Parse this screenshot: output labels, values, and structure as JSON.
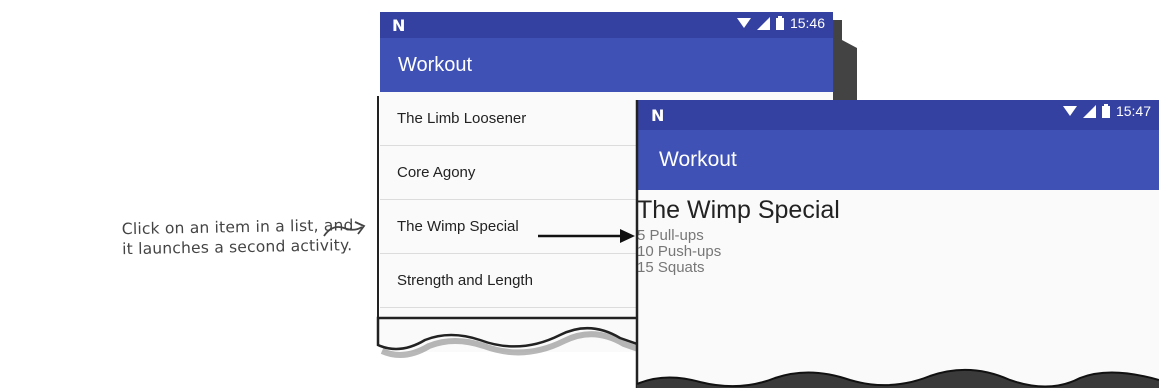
{
  "annotation": {
    "line1": "Click on an item in a list, and",
    "line2": "it launches a second activity."
  },
  "screen1": {
    "status": {
      "logo": "N",
      "time": "15:46"
    },
    "app_title": "Workout",
    "items": [
      {
        "label": "The Limb Loosener"
      },
      {
        "label": "Core Agony"
      },
      {
        "label": "The Wimp Special"
      },
      {
        "label": "Strength and Length"
      }
    ]
  },
  "screen2": {
    "status": {
      "logo": "N",
      "time": "15:47"
    },
    "app_title": "Workout",
    "detail_title": "The Wimp Special",
    "detail_lines": [
      "5 Pull-ups",
      "10 Push-ups",
      "15 Squats"
    ]
  },
  "colors": {
    "status_bar": "#3441a1",
    "app_bar": "#3f51b5",
    "background": "#fafafa"
  },
  "icons": [
    "wifi-icon",
    "no-signal-icon",
    "battery-icon"
  ]
}
